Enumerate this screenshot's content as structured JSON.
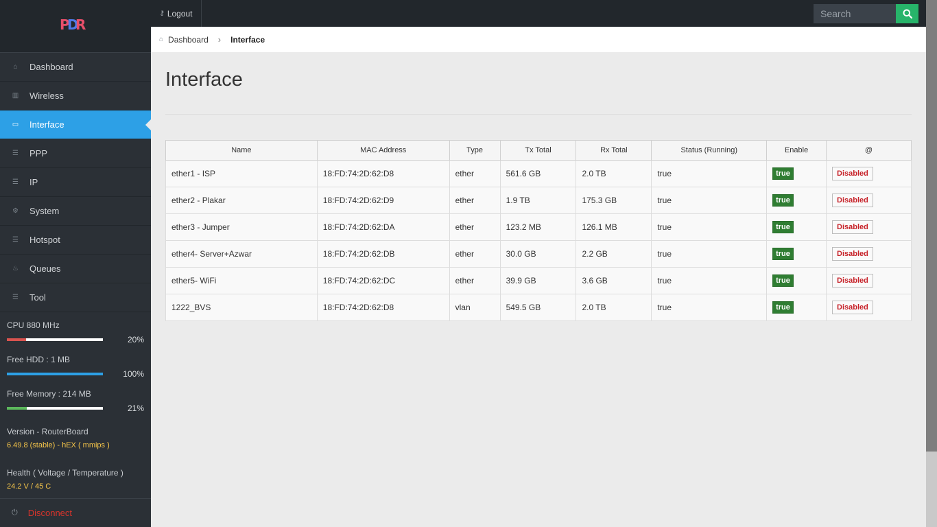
{
  "brand": {
    "logo_text_1": "P",
    "logo_text_2": "D",
    "logo_text_3": "R"
  },
  "topbar": {
    "logout_label": "Logout",
    "search_placeholder": "Search"
  },
  "sidebar": {
    "items": [
      {
        "label": "Dashboard",
        "icon": "home-icon",
        "active": false
      },
      {
        "label": "Wireless",
        "icon": "chart-icon",
        "active": false
      },
      {
        "label": "Interface",
        "icon": "hdd-icon",
        "active": true
      },
      {
        "label": "PPP",
        "icon": "list-icon",
        "active": false
      },
      {
        "label": "IP",
        "icon": "list-icon",
        "active": false
      },
      {
        "label": "System",
        "icon": "cogs-icon",
        "active": false
      },
      {
        "label": "Hotspot",
        "icon": "list-icon",
        "active": false
      },
      {
        "label": "Queues",
        "icon": "fire-icon",
        "active": false
      },
      {
        "label": "Tool",
        "icon": "list-icon",
        "active": false
      }
    ],
    "stats": [
      {
        "label": "CPU 880 MHz",
        "percent": "20%",
        "fill": 0.2,
        "color": "#d9534f"
      },
      {
        "label": "Free HDD : 1 MB",
        "percent": "100%",
        "fill": 1.0,
        "color": "#2da0e6"
      },
      {
        "label": "Free Memory : 214 MB",
        "percent": "21%",
        "fill": 0.21,
        "color": "#5cb85c"
      }
    ],
    "version_label": "Version - RouterBoard",
    "version_value": "6.49.8 (stable) - hEX ( mmips )",
    "health_label": "Health ( Voltage / Temperature )",
    "health_value": "24.2 V / 45 C",
    "disconnect_label": "Disconnect"
  },
  "breadcrumb": {
    "home": "Dashboard",
    "current": "Interface"
  },
  "page_title": "Interface",
  "table": {
    "headers": [
      "Name",
      "MAC Address",
      "Type",
      "Tx Total",
      "Rx Total",
      "Status (Running)",
      "Enable",
      "@"
    ],
    "rows": [
      {
        "name": "ether1 - ISP",
        "mac": "18:FD:74:2D:62:D8",
        "type": "ether",
        "tx": "561.6 GB",
        "rx": "2.0 TB",
        "status": "true",
        "enable": "true",
        "action": "Disabled"
      },
      {
        "name": "ether2 - Plakar",
        "mac": "18:FD:74:2D:62:D9",
        "type": "ether",
        "tx": "1.9 TB",
        "rx": "175.3 GB",
        "status": "true",
        "enable": "true",
        "action": "Disabled"
      },
      {
        "name": "ether3 - Jumper",
        "mac": "18:FD:74:2D:62:DA",
        "type": "ether",
        "tx": "123.2 MB",
        "rx": "126.1 MB",
        "status": "true",
        "enable": "true",
        "action": "Disabled"
      },
      {
        "name": "ether4- Server+Azwar",
        "mac": "18:FD:74:2D:62:DB",
        "type": "ether",
        "tx": "30.0 GB",
        "rx": "2.2 GB",
        "status": "true",
        "enable": "true",
        "action": "Disabled"
      },
      {
        "name": "ether5- WiFi",
        "mac": "18:FD:74:2D:62:DC",
        "type": "ether",
        "tx": "39.9 GB",
        "rx": "3.6 GB",
        "status": "true",
        "enable": "true",
        "action": "Disabled"
      },
      {
        "name": "1222_BVS",
        "mac": "18:FD:74:2D:62:D8",
        "type": "vlan",
        "tx": "549.5 GB",
        "rx": "2.0 TB",
        "status": "true",
        "enable": "true",
        "action": "Disabled"
      }
    ]
  }
}
